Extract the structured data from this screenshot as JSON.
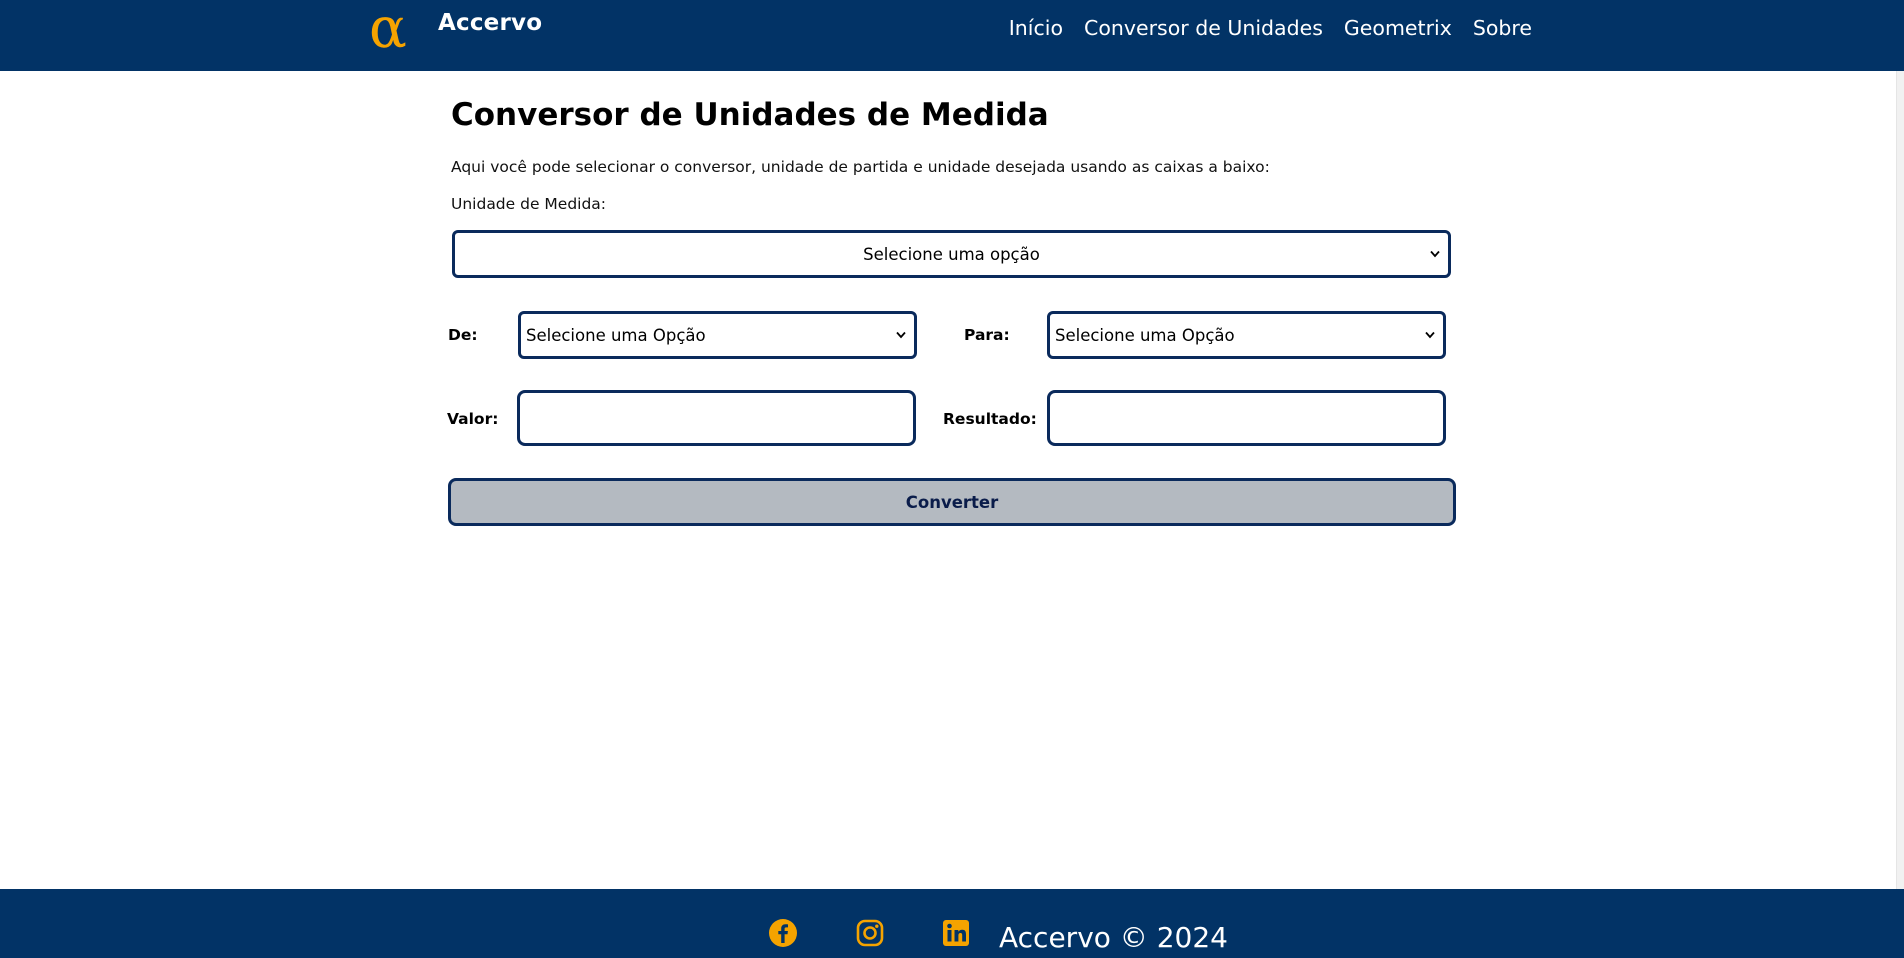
{
  "header": {
    "brand": "Accervo",
    "logo_icon": "alpha-icon",
    "nav": [
      "Início",
      "Conversor de Unidades",
      "Geometrix",
      "Sobre"
    ]
  },
  "main": {
    "title": "Conversor de Unidades de Medida",
    "description": "Aqui você pode selecionar o conversor, unidade de partida e unidade desejada usando as caixas a baixo:",
    "unit_label": "Unidade de Medida:",
    "unit_select_value": "Selecione uma opção",
    "from_label": "De:",
    "from_select_value": "Selecione uma Opção",
    "to_label": "Para:",
    "to_select_value": "Selecione uma Opção",
    "value_label": "Valor:",
    "value_input": "",
    "result_label": "Resultado:",
    "result_input": "",
    "convert_label": "Converter"
  },
  "footer": {
    "icons": [
      "facebook-icon",
      "instagram-icon",
      "linkedin-icon"
    ],
    "text": "Accervo © 2024"
  },
  "colors": {
    "header_bg": "#023366",
    "accent": "#f5a300",
    "border": "#0a2a5c",
    "button_bg": "#b4bac1"
  }
}
